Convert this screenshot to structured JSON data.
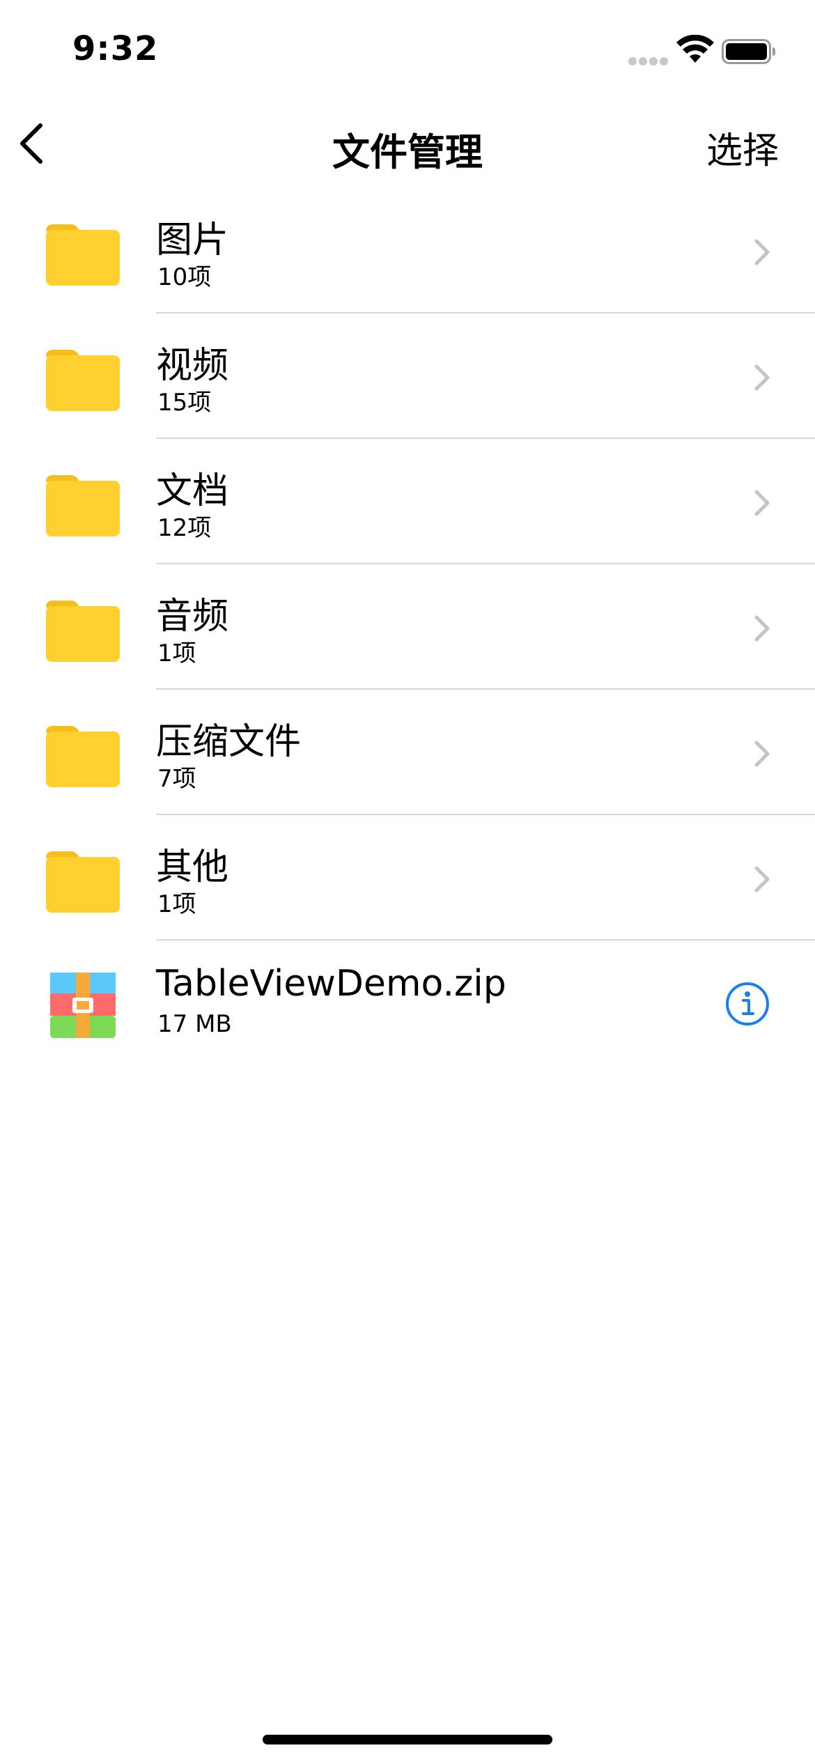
{
  "status_bar": {
    "time": "9:32",
    "icons": [
      "cellular-dots-icon",
      "wifi-icon",
      "battery-icon"
    ]
  },
  "nav": {
    "back_icon": "chevron-left-icon",
    "title": "文件管理",
    "select_label": "选择"
  },
  "colors": {
    "folder": "#FFD02F",
    "folder_tab": "#F5BE1A",
    "chevron": "#C4C4C7",
    "info_accent": "#1A7FE8",
    "separator": "#D9D9DC"
  },
  "items": [
    {
      "name": "图片",
      "detail": "10项",
      "type": "folder"
    },
    {
      "name": "视频",
      "detail": "15项",
      "type": "folder"
    },
    {
      "name": "文档",
      "detail": "12项",
      "type": "folder"
    },
    {
      "name": "音频",
      "detail": "1项",
      "type": "folder"
    },
    {
      "name": "压缩文件",
      "detail": "7项",
      "type": "folder"
    },
    {
      "name": "其他",
      "detail": "1项",
      "type": "folder"
    },
    {
      "name": "TableViewDemo.zip",
      "detail": "17 MB",
      "type": "zip-file"
    }
  ]
}
